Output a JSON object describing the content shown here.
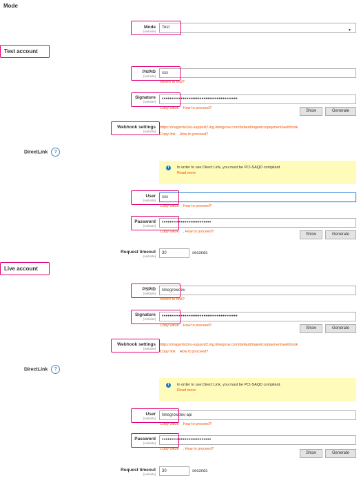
{
  "mode_section": {
    "title": "Mode"
  },
  "mode": {
    "label": "Mode",
    "scope": "[website]",
    "value": "Test"
  },
  "test": {
    "title": "Test account",
    "pspid": {
      "label": "PSPID",
      "scope": "[website]",
      "value": "xxx",
      "hint": "Where to find?"
    },
    "signature": {
      "label": "Signature",
      "scope": "[website]",
      "value": "••••••••••••••••••••••••••••••••••••••••",
      "copy": "Copy value",
      "proceed": "How to proceed?",
      "show": "Show",
      "generate": "Generate"
    },
    "webhook": {
      "label": "Webhook settings",
      "scope": "[website]",
      "url": "https://magento2os-support2.ing.limegrow.com/default/ingenico/payment/webhook",
      "copy": "Copy link",
      "proceed": "How to proceed?"
    },
    "directlink": {
      "title": "DirectLink",
      "help": "?",
      "info": "In order to use Direct Link, you must be PCI-SAQD compliant.",
      "read_more": "Read more"
    },
    "user": {
      "label": "User",
      "scope": "[website]",
      "value": "xxx",
      "copy": "Copy value",
      "proceed": "How to proceed?"
    },
    "password": {
      "label": "Password",
      "scope": "[website]",
      "value": "••••••••••••••••••••••••••",
      "copy": "Copy value",
      "proceed": ", How to proceed?",
      "show": "Show",
      "generate": "Generate"
    },
    "timeout": {
      "label": "Request timeout",
      "scope": "[website]",
      "value": "30",
      "unit": "seconds"
    }
  },
  "live": {
    "title": "Live account",
    "pspid": {
      "label": "PSPID",
      "scope": "[website]",
      "value": "limegrowdev",
      "hint": "Where to find?"
    },
    "signature": {
      "label": "Signature",
      "scope": "[website]",
      "value": "••••••••••••••••••••••••••••••••••••••••",
      "copy": "Copy value",
      "proceed": "How to proceed?",
      "show": "Show",
      "generate": "Generate"
    },
    "webhook": {
      "label": "Webhook settings",
      "scope": "[website]",
      "url": "https://magento2os-support2.ing.limegrow.com/default/ingenico/payment/webhook",
      "copy": "Copy link",
      "proceed": "How to proceed?"
    },
    "directlink": {
      "title": "DirectLink",
      "help": "?",
      "info": "In order to use Direct Link, you must be PCI-SAQD compliant.",
      "read_more": "Read more"
    },
    "user": {
      "label": "User",
      "scope": "[website]",
      "value": "limegrowdev-api",
      "copy": "Copy value",
      "proceed": "How to proceed?"
    },
    "password": {
      "label": "Password",
      "scope": "[website]",
      "value": "••••••••••••••••••••••••••",
      "copy": "Copy value",
      "proceed": ", How to proceed?",
      "show": "Show",
      "generate": "Generate"
    },
    "timeout": {
      "label": "Request timeout",
      "scope": "[website]",
      "value": "30",
      "unit": "seconds"
    }
  },
  "colors": {
    "highlight": "#e0007a",
    "link": "#eb5202",
    "info_bg": "#fffbbb",
    "info_icon": "#1979c3",
    "help": "#4a87c7"
  }
}
